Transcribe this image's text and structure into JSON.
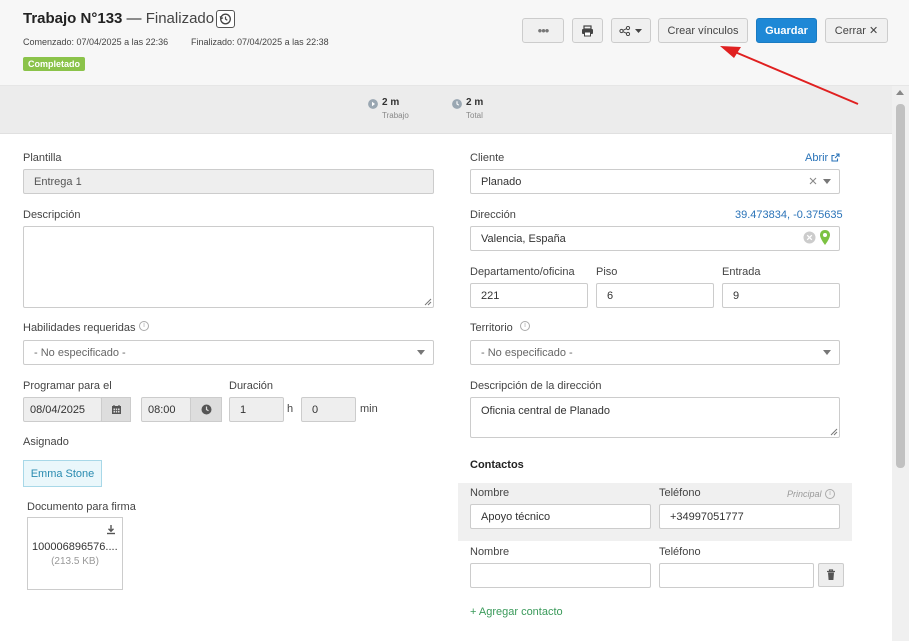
{
  "header": {
    "title_prefix": "Trabajo N°133",
    "title_sep": " — ",
    "title_status": "Finalizado",
    "started": "Comenzado: 07/04/2025 a las 22:36",
    "finished": "Finalizado: 07/04/2025 a las 22:38",
    "badge": "Completado",
    "buttons": {
      "more": "•••",
      "create_links": "Crear vínculos",
      "save": "Guardar",
      "close": "Cerrar ✕"
    }
  },
  "summary": {
    "work_value": "2 m",
    "work_label": "Trabajo",
    "total_value": "2 m",
    "total_label": "Total"
  },
  "form": {
    "template_label": "Plantilla",
    "template_value": "Entrega 1",
    "description_label": "Descripción",
    "description_value": "",
    "skills_label": "Habilidades requeridas",
    "skills_value": "- No especificado -",
    "schedule_label": "Programar para el",
    "date_value": "08/04/2025",
    "time_value": "08:00",
    "duration_label": "Duración",
    "duration_h_value": "1",
    "duration_h_unit": "h",
    "duration_min_value": "0",
    "duration_min_unit": "min",
    "assigned_label": "Asignado",
    "assignee": "Emma Stone",
    "doc_label": "Documento para firma",
    "doc_name": "100006896576....",
    "doc_size": "(213.5 KB)",
    "client_label": "Cliente",
    "client_link": "Abrir",
    "client_value": "Planado",
    "address_label": "Dirección",
    "address_coords": "39.473834, -0.375635",
    "address_value": "Valencia, España",
    "dept_label": "Departamento/oficina",
    "dept_value": "221",
    "floor_label": "Piso",
    "floor_value": "6",
    "entrance_label": "Entrada",
    "entrance_value": "9",
    "territory_label": "Territorio",
    "territory_value": "- No especificado -",
    "address_desc_label": "Descripción de la dirección",
    "address_desc_value": "Oficnia central de Planado",
    "contacts_title": "Contactos",
    "contact1_name_label": "Nombre",
    "contact1_phone_label": "Teléfono",
    "contact1_principal": "Principal",
    "contact1_name": "Apoyo técnico",
    "contact1_phone": "+34997051777",
    "contact2_name_label": "Nombre",
    "contact2_phone_label": "Teléfono",
    "add_contact": "Agregar contacto"
  },
  "colors": {
    "primary": "#1e88d6",
    "badge": "#8bc34a",
    "link": "#2a73b8",
    "annotation_arrow": "#e02020",
    "map_pin": "#7cc242"
  },
  "icons": [
    "history-icon",
    "print-icon",
    "share-icon",
    "chevron-down-icon",
    "play-circle-icon",
    "clock-icon",
    "external-link-icon",
    "clear-icon",
    "map-pin-icon",
    "calendar-icon",
    "info-icon",
    "download-icon",
    "trash-icon",
    "plus-icon"
  ]
}
